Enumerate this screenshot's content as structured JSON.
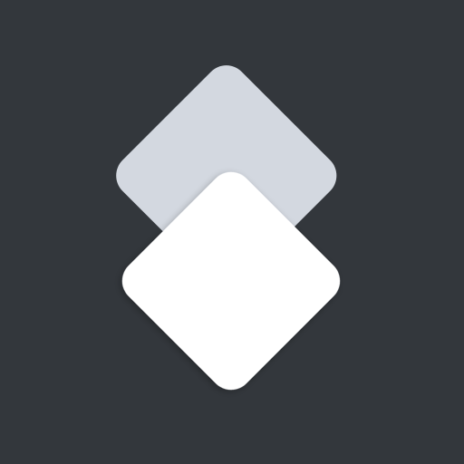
{
  "icon": {
    "name": "stacked-layers-icon",
    "colors": {
      "background": "#33373c",
      "back_layer": "#d3d8e0",
      "front_layer": "#ffffff"
    }
  }
}
